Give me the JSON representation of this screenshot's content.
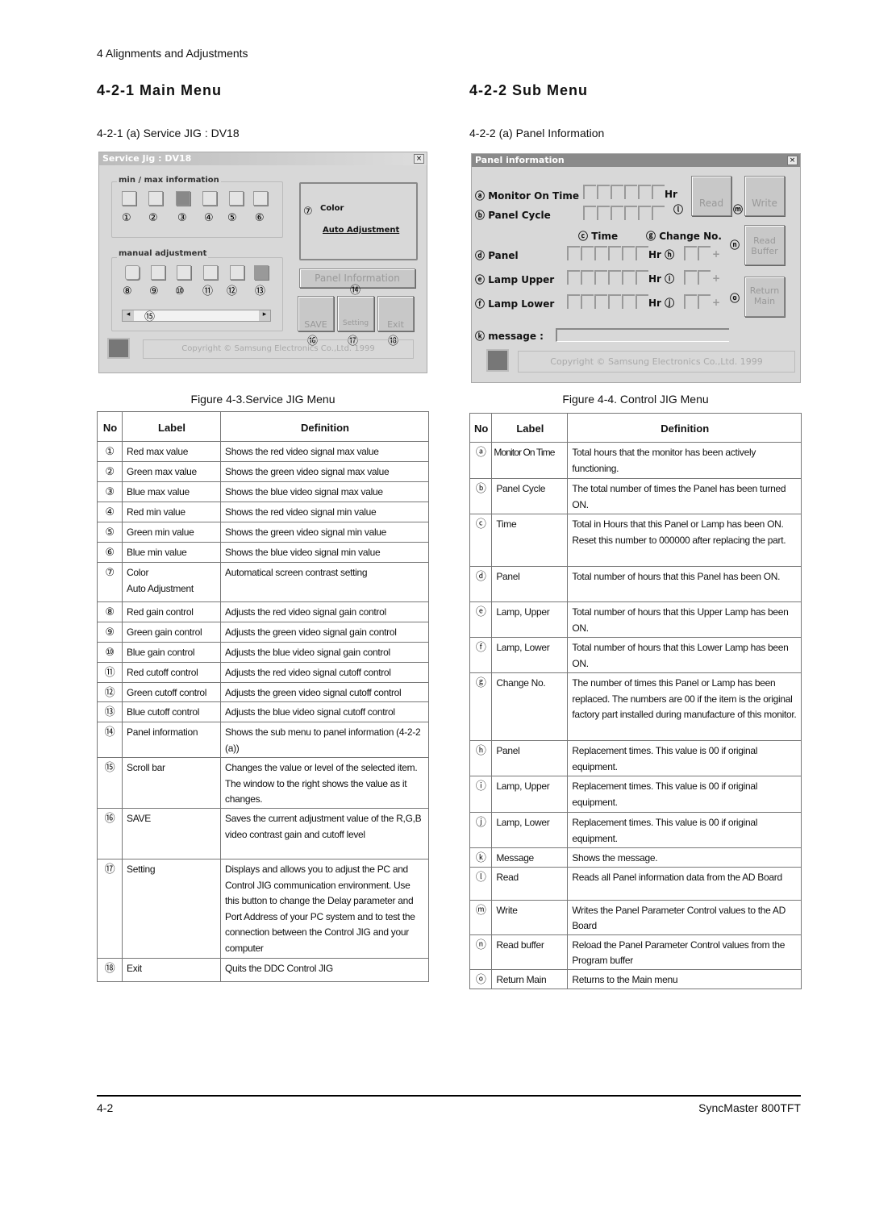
{
  "header": "4 Alignments and Adjustments",
  "left": {
    "title": "4-2-1   Main Menu",
    "subtitle": "4-2-1 (a) Service JIG : DV18",
    "caption": "Figure 4-3.Service JIG Menu",
    "window": {
      "title": "Service Jig : DV18",
      "close": "×",
      "group1": "min / max information",
      "group2": "manual adjustment",
      "color": "Color",
      "auto": "Auto Adjustment",
      "panel_btn": "Panel Information",
      "save": "SAVE",
      "setting": "Setting",
      "exit": "Exit",
      "copyright": "Copyright ©  Samsung Electronics Co.,Ltd. 1999",
      "markers": [
        "①",
        "②",
        "③",
        "④",
        "⑤",
        "⑥",
        "⑦",
        "⑧",
        "⑨",
        "⑩",
        "⑪",
        "⑫",
        "⑬",
        "⑭",
        "⑮",
        "⑯",
        "⑰",
        "⑱"
      ],
      "scroll_left": "◂",
      "scroll_right": "▸"
    },
    "table": {
      "headers": [
        "No",
        "Label",
        "Definition"
      ],
      "rows": [
        [
          "①",
          "Red max value",
          "Shows the red video signal max value"
        ],
        [
          "②",
          "Green max value",
          "Shows the green video signal max value"
        ],
        [
          "③",
          "Blue max value",
          "Shows the blue video signal max value"
        ],
        [
          "④",
          "Red min value",
          "Shows the red video signal min value"
        ],
        [
          "⑤",
          "Green min value",
          "Shows the green video signal min value"
        ],
        [
          "⑥",
          "Blue min value",
          "Shows the blue video signal min value"
        ],
        [
          "⑦",
          "Color\nAuto Adjustment",
          "Automatical screen contrast setting"
        ],
        [
          "⑧",
          "Red gain control",
          "Adjusts the red video signal gain control"
        ],
        [
          "⑨",
          "Green gain control",
          "Adjusts the green video signal gain control"
        ],
        [
          "⑩",
          "Blue gain control",
          "Adjusts the blue video signal gain control"
        ],
        [
          "⑪",
          "Red cutoff control",
          "Adjusts the red video signal cutoff control"
        ],
        [
          "⑫",
          "Green cutoff control",
          "Adjusts the green video signal cutoff control"
        ],
        [
          "⑬",
          "Blue cutoff control",
          "Adjusts the blue video signal cutoff control"
        ],
        [
          "⑭",
          "Panel information",
          "Shows the sub menu to panel information (4-2-2 (a))"
        ],
        [
          "⑮",
          "Scroll bar",
          "Changes the value or level of the  selected item. The window to the right shows the value as it changes."
        ],
        [
          "⑯",
          "SAVE",
          "Saves the current adjustment value of the R,G,B video contrast gain and cutoff level"
        ],
        [
          "⑰",
          "Setting",
          "Displays and allows you to adjust the PC and Control JIG communication environment. Use this button to change  the Delay parameter and Port Address of your PC system and to test the connection between the Control JIG and your computer"
        ],
        [
          "⑱",
          "Exit",
          "Quits the DDC Control JIG"
        ]
      ]
    }
  },
  "right": {
    "title": "4-2-2 Sub Menu",
    "subtitle": "4-2-2 (a) Panel Information",
    "caption": "Figure 4-4. Control JIG Menu",
    "window": {
      "title": "Panel information",
      "close": "×",
      "monitor_on_time": "Monitor On Time",
      "panel_cycle": "Panel Cycle",
      "time": "Time",
      "change_no": "Change No.",
      "panel": "Panel",
      "lamp_upper": "Lamp Upper",
      "lamp_lower": "Lamp Lower",
      "hr": "Hr",
      "message": "message :",
      "read": "Read",
      "write": "Write",
      "read_buffer": "Read Buffer",
      "return_main": "Return Main",
      "copyright": "Copyright ©  Samsung Electronics Co.,Ltd. 1999",
      "markers": [
        "ⓐ",
        "ⓑ",
        "ⓒ",
        "ⓓ",
        "ⓔ",
        "ⓕ",
        "ⓖ",
        "ⓗ",
        "ⓘ",
        "ⓙ",
        "ⓚ",
        "ⓛ",
        "ⓜ",
        "ⓝ",
        "ⓞ"
      ],
      "plus": "+"
    },
    "table": {
      "headers": [
        "No",
        "Label",
        "Definition"
      ],
      "rows": [
        [
          "ⓐ",
          "Monitor On Time",
          "Total hours that the monitor has been actively functioning."
        ],
        [
          "ⓑ",
          "Panel Cycle",
          "The total number of times the Panel has been turned ON."
        ],
        [
          "ⓒ",
          "Time",
          "Total in Hours that this Panel or Lamp has been ON. Reset this number to 000000 after replacing the part."
        ],
        [
          "ⓓ",
          "Panel",
          "Total number of hours that this Panel has been ON."
        ],
        [
          "ⓔ",
          "Lamp, Upper",
          "Total number of hours that this Upper Lamp has been ON."
        ],
        [
          "ⓕ",
          "Lamp, Lower",
          "Total number of hours that this Lower Lamp has been ON."
        ],
        [
          "ⓖ",
          "Change No.",
          "The number of times this Panel or Lamp has been replaced. The numbers are 00 if the item is the original factory part installed during manufacture of this monitor."
        ],
        [
          "ⓗ",
          "Panel",
          "Replacement times. This value is 00 if original equipment."
        ],
        [
          "ⓘ",
          "Lamp, Upper",
          "Replacement times. This value is 00 if original equipment."
        ],
        [
          "ⓙ",
          "Lamp, Lower",
          "Replacement times. This value is 00 if original equipment."
        ],
        [
          "ⓚ",
          "Message",
          "Shows the message."
        ],
        [
          "ⓛ",
          "Read",
          "Reads all Panel information data from the AD Board"
        ],
        [
          "ⓜ",
          "Write",
          "Writes the Panel Parameter Control values to the AD Board"
        ],
        [
          "ⓝ",
          "Read buffer",
          "Reload the Panel Parameter Control values from the Program buffer"
        ],
        [
          "ⓞ",
          "Return Main",
          "Returns to the Main menu"
        ]
      ]
    }
  },
  "footer": {
    "page": "4-2",
    "model": "SyncMaster 800TFT"
  }
}
